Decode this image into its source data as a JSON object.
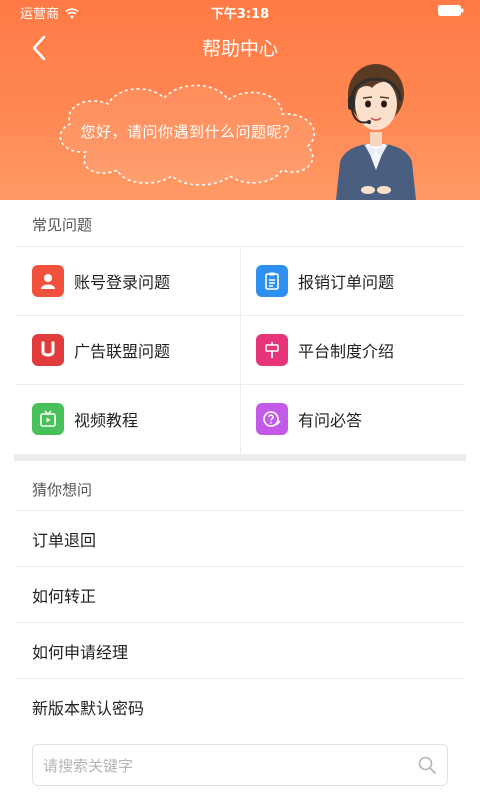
{
  "status_bar": {
    "carrier": "运营商",
    "time": "下午3:18",
    "wifi_icon": "wifi-icon",
    "battery_icon": "battery-icon"
  },
  "nav": {
    "title": "帮助中心",
    "back_icon": "chevron-left-icon"
  },
  "banner": {
    "greeting": "您好，请问你遇到什么问题呢？",
    "gradient_colors": [
      "#ff7a45",
      "#ff9a66"
    ]
  },
  "common": {
    "title": "常见问题",
    "items": [
      {
        "label": "账号登录问题",
        "icon": "user-icon",
        "color": "#f0503c"
      },
      {
        "label": "报销订单问题",
        "icon": "clipboard-icon",
        "color": "#2f8fef"
      },
      {
        "label": "广告联盟问题",
        "icon": "u-letter-icon",
        "color": "#e23b3b"
      },
      {
        "label": "平台制度介绍",
        "icon": "signpost-icon",
        "color": "#e8357a"
      },
      {
        "label": "视频教程",
        "icon": "video-icon",
        "color": "#48c15a"
      },
      {
        "label": "有问必答",
        "icon": "question-pen-icon",
        "color": "#c45be8"
      }
    ]
  },
  "guess": {
    "title": "猜你想问",
    "items": [
      {
        "label": "订单退回"
      },
      {
        "label": "如何转正"
      },
      {
        "label": "如何申请经理"
      },
      {
        "label": "新版本默认密码"
      }
    ]
  },
  "search": {
    "placeholder": "请搜索关键字",
    "value": "",
    "icon": "search-icon"
  }
}
